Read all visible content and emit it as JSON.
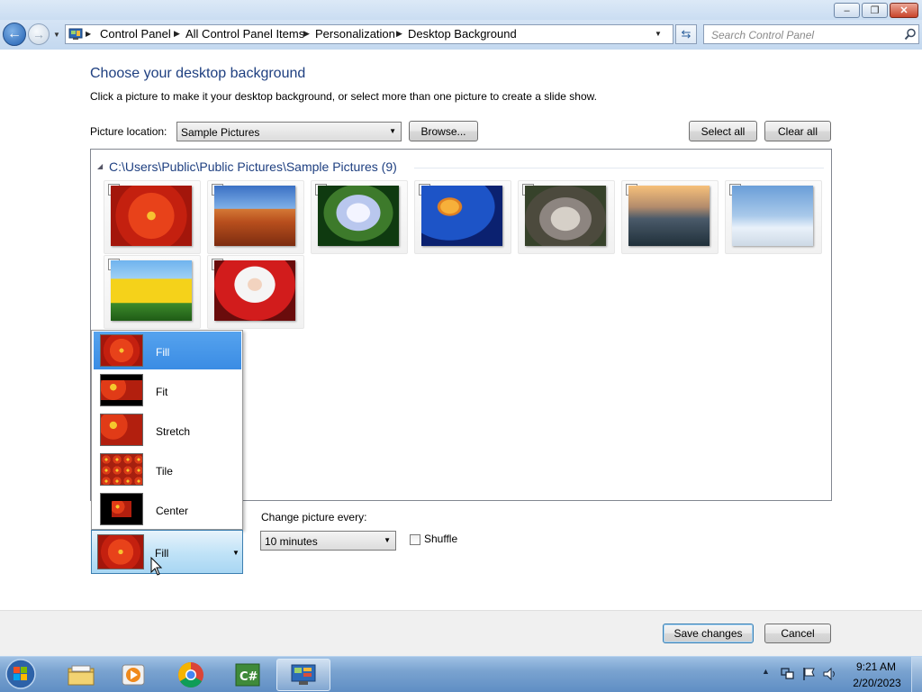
{
  "window": {
    "minimize": "–",
    "restore": "❐",
    "close": "✕"
  },
  "nav": {
    "breadcrumbs": [
      "Control Panel",
      "All Control Panel Items",
      "Personalization",
      "Desktop Background"
    ],
    "search_placeholder": "Search Control Panel"
  },
  "content": {
    "title": "Choose your desktop background",
    "subtitle": "Click a picture to make it your desktop background, or select more than one picture to create a slide show.",
    "picture_location_label": "Picture location:",
    "picture_location_value": "Sample Pictures",
    "browse_label": "Browse...",
    "select_all_label": "Select all",
    "clear_all_label": "Clear all",
    "group_header": "C:\\Users\\Public\\Public Pictures\\Sample Pictures (9)",
    "pictures": [
      {
        "name": "Chrysanthemum",
        "checked": true
      },
      {
        "name": "Desert",
        "checked": true
      },
      {
        "name": "Hydrangeas",
        "checked": true
      },
      {
        "name": "Jellyfish",
        "checked": true
      },
      {
        "name": "Koala",
        "checked": true
      },
      {
        "name": "Lighthouse",
        "checked": true
      },
      {
        "name": "Penguins",
        "checked": true
      },
      {
        "name": "Tulips",
        "checked": true
      },
      {
        "name": "Santa",
        "checked": true
      }
    ]
  },
  "picture_position": {
    "selected": "Fill",
    "options": [
      "Fill",
      "Fit",
      "Stretch",
      "Tile",
      "Center"
    ]
  },
  "slideshow": {
    "change_label": "Change picture every:",
    "interval_value": "10 minutes",
    "shuffle_label": "Shuffle",
    "shuffle_checked": false
  },
  "footer": {
    "save_label": "Save changes",
    "cancel_label": "Cancel"
  },
  "taskbar": {
    "apps": [
      "start-orb",
      "file-explorer-icon",
      "media-player-icon",
      "chrome-icon",
      "csharp-project-icon",
      "control-panel-icon"
    ],
    "time": "9:21 AM",
    "date": "2/20/2023"
  },
  "colors": {
    "title_blue": "#1e3f80",
    "selection_blue": "#3a8ce4",
    "taskbar": "#6f9ad0"
  }
}
